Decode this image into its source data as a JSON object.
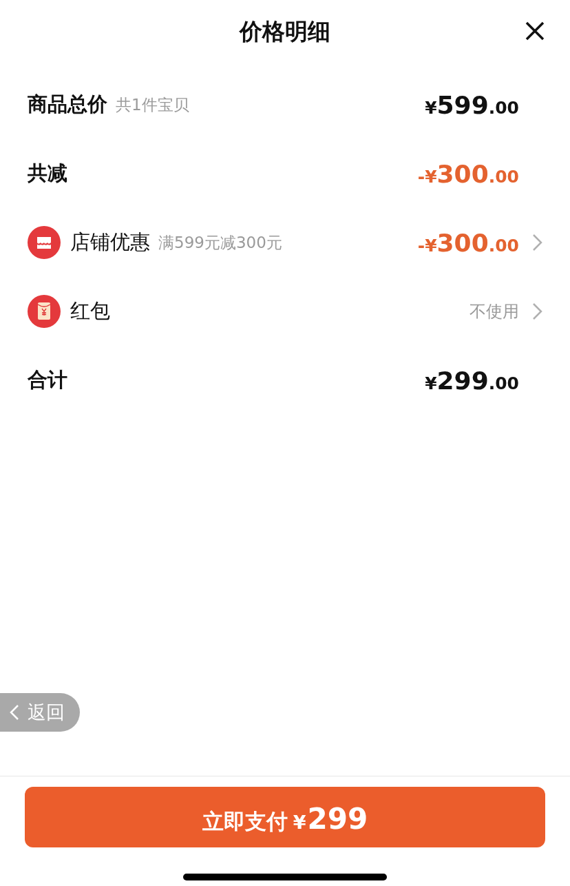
{
  "title": "价格明细",
  "rows": [
    {
      "kind": "subtotal",
      "label": "商品总价",
      "note": "共1件宝贝",
      "amount": "¥599.00"
    },
    {
      "kind": "discount",
      "label": "共减",
      "amount": "-¥300.00"
    },
    {
      "kind": "shop",
      "label": "店铺优惠",
      "note": "满599元减300元",
      "amount": "-¥300.00"
    },
    {
      "kind": "packet",
      "label": "红包",
      "value": "不使用"
    },
    {
      "kind": "total",
      "label": "合计",
      "amount": "¥299.00"
    }
  ],
  "back_button": "返回",
  "pay_button": {
    "label": "立即支付",
    "amount": "¥299"
  }
}
